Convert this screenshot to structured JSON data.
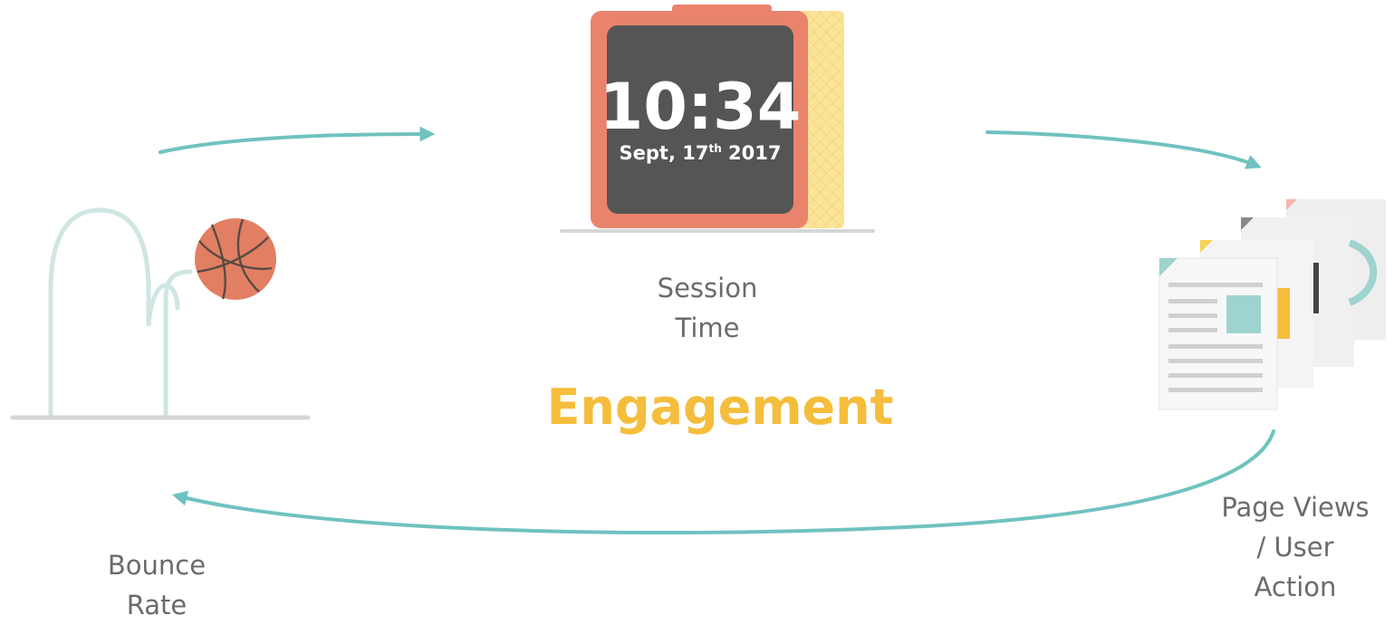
{
  "title": "Engagement",
  "clock": {
    "time": "10:34",
    "date_prefix": "Sept, 17",
    "date_suffix": "th",
    "date_year": " 2017"
  },
  "labels": {
    "session": [
      "Session",
      "Time"
    ],
    "bounce": [
      "Bounce",
      "Rate"
    ],
    "pageviews": [
      "Page Views",
      "/ User",
      "Action"
    ]
  },
  "colors": {
    "arrow": "#6fc2bf",
    "title": "#f5bd3c",
    "clock_frame": "#e9836c",
    "clock_screen": "#555555",
    "basketball": "#e27f63",
    "ground": "#d6d6d6"
  },
  "icons": [
    "basketball-icon",
    "clock-icon",
    "documents-icon"
  ]
}
